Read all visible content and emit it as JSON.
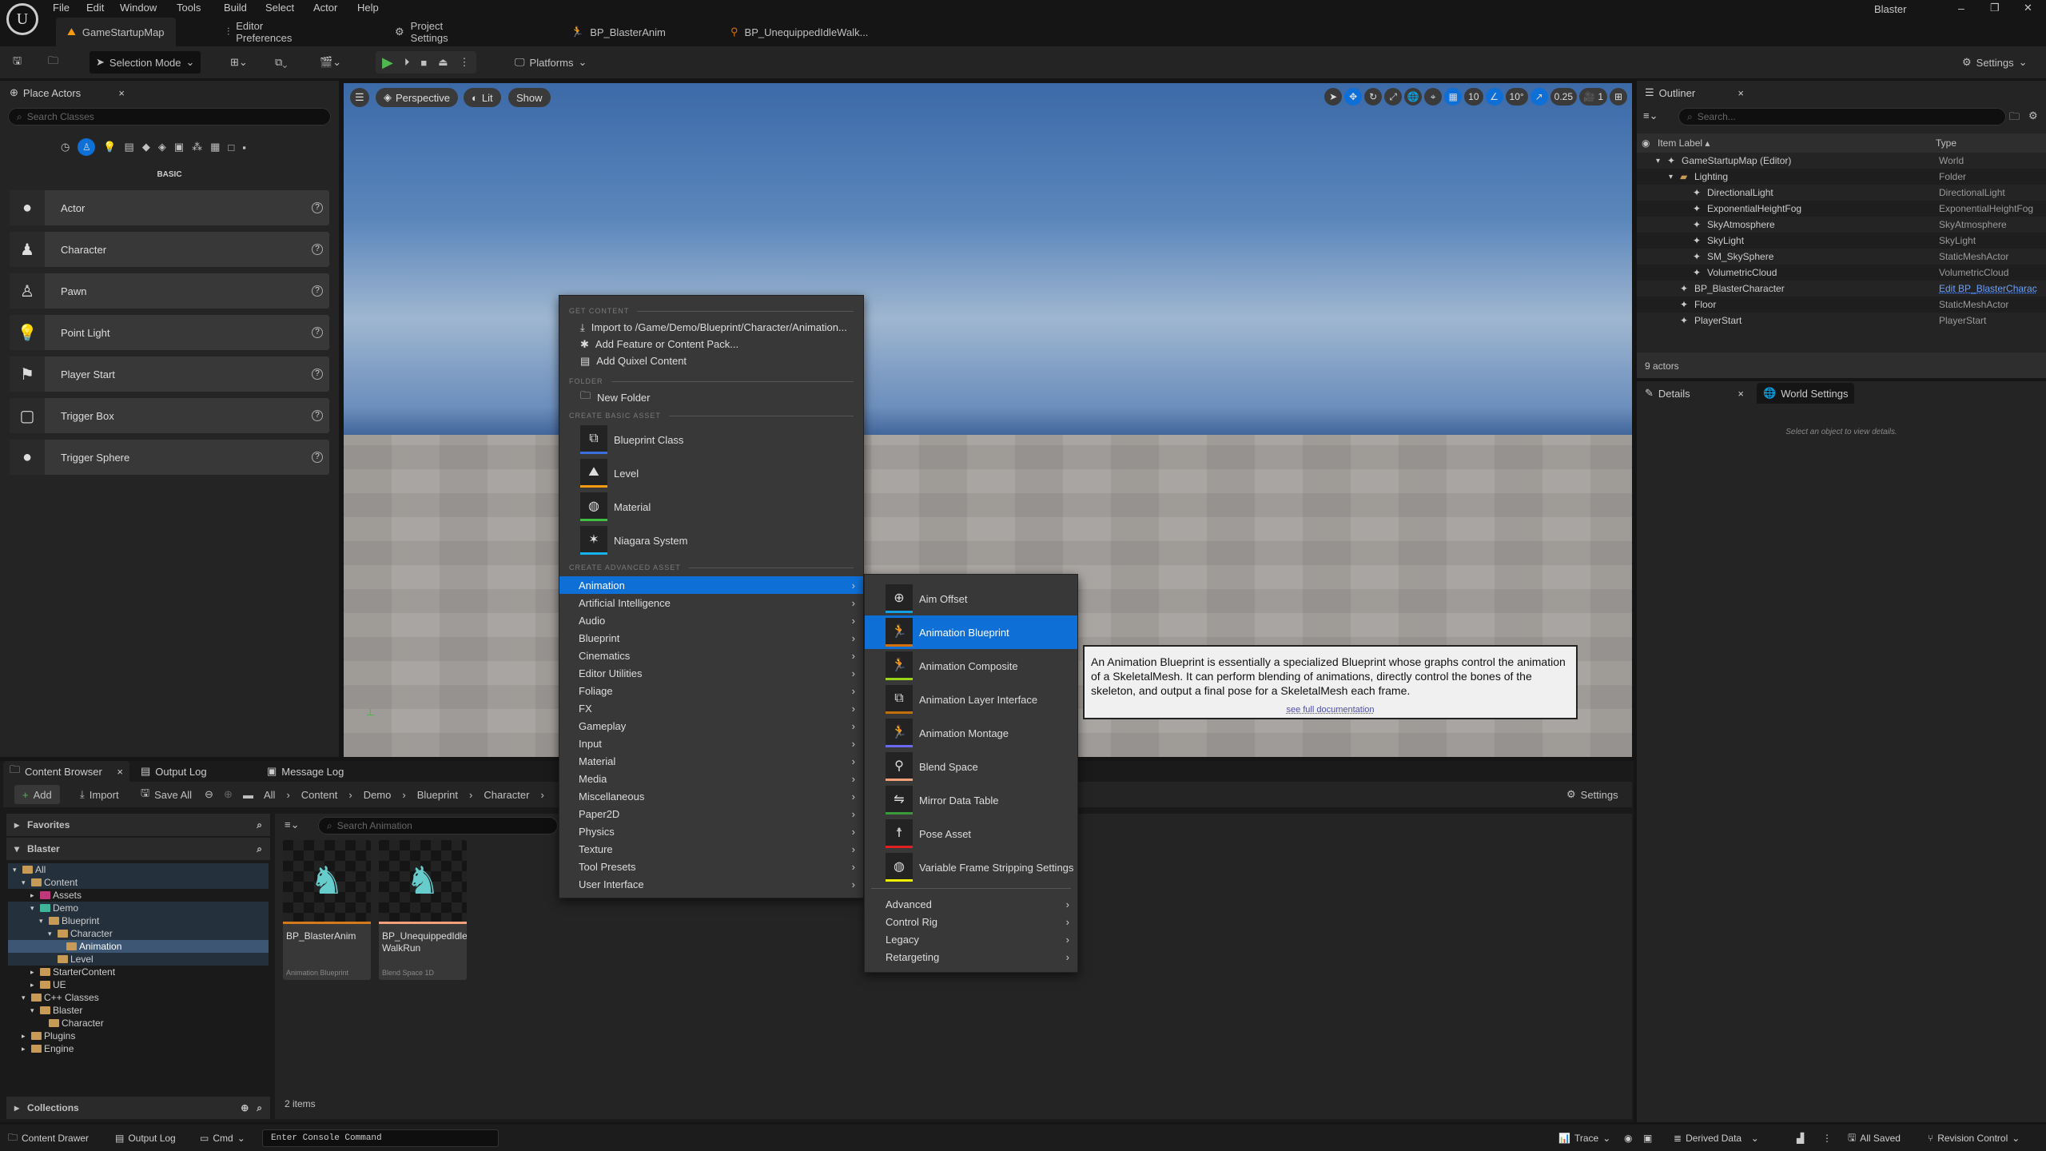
{
  "menubar": {
    "items": [
      "File",
      "Edit",
      "Window",
      "Tools",
      "Build",
      "Select",
      "Actor",
      "Help"
    ],
    "project": "Blaster"
  },
  "tabs": [
    {
      "label": "GameStartupMap",
      "icon": "level-icon"
    },
    {
      "label": "Editor Preferences",
      "icon": "sliders-icon"
    },
    {
      "label": "Project Settings",
      "icon": "gear-icon"
    },
    {
      "label": "BP_BlasterAnim",
      "icon": "anim-blueprint-icon"
    },
    {
      "label": "BP_UnequippedIdleWalk...",
      "icon": "blend-space-icon"
    }
  ],
  "toolbar": {
    "selection_mode": "Selection Mode",
    "platforms": "Platforms",
    "settings": "Settings"
  },
  "place_actors": {
    "title": "Place Actors",
    "search_placeholder": "Search Classes",
    "category": "BASIC",
    "items": [
      {
        "label": "Actor",
        "icon": "sphere-icon"
      },
      {
        "label": "Character",
        "icon": "character-icon"
      },
      {
        "label": "Pawn",
        "icon": "pawn-icon"
      },
      {
        "label": "Point Light",
        "icon": "bulb-icon"
      },
      {
        "label": "Player Start",
        "icon": "flag-icon"
      },
      {
        "label": "Trigger Box",
        "icon": "box-icon"
      },
      {
        "label": "Trigger Sphere",
        "icon": "sphere-icon"
      }
    ]
  },
  "viewport": {
    "perspective": "Perspective",
    "lit": "Lit",
    "show": "Show",
    "grid": "10",
    "angle": "10°",
    "scale": "0.25",
    "camera": "1"
  },
  "outliner": {
    "title": "Outliner",
    "search_placeholder": "Search...",
    "col_label": "Item Label",
    "col_type": "Type",
    "rows": [
      {
        "label": "GameStartupMap (Editor)",
        "type": "World",
        "depth": 0
      },
      {
        "label": "Lighting",
        "type": "Folder",
        "depth": 1
      },
      {
        "label": "DirectionalLight",
        "type": "DirectionalLight",
        "depth": 2
      },
      {
        "label": "ExponentialHeightFog",
        "type": "ExponentialHeightFog",
        "depth": 2
      },
      {
        "label": "SkyAtmosphere",
        "type": "SkyAtmosphere",
        "depth": 2
      },
      {
        "label": "SkyLight",
        "type": "SkyLight",
        "depth": 2
      },
      {
        "label": "SM_SkySphere",
        "type": "StaticMeshActor",
        "depth": 2
      },
      {
        "label": "VolumetricCloud",
        "type": "VolumetricCloud",
        "depth": 2
      },
      {
        "label": "BP_BlasterCharacter",
        "type": "Edit BP_BlasterCharac",
        "depth": 1,
        "link": true
      },
      {
        "label": "Floor",
        "type": "StaticMeshActor",
        "depth": 1
      },
      {
        "label": "PlayerStart",
        "type": "PlayerStart",
        "depth": 1
      }
    ],
    "count": "9 actors"
  },
  "details": {
    "tab": "Details",
    "world_settings": "World Settings",
    "empty": "Select an object to view details."
  },
  "bottom_tabs": {
    "content_browser": "Content Browser",
    "output_log": "Output Log",
    "message_log": "Message Log"
  },
  "content_browser": {
    "add": "Add",
    "import": "Import",
    "save_all": "Save All",
    "settings": "Settings",
    "breadcrumb": [
      "All",
      "Content",
      "Demo",
      "Blueprint",
      "Character"
    ],
    "favorites": "Favorites",
    "root": "Blaster",
    "collections": "Collections",
    "search_placeholder": "Search Animation",
    "count": "2 items",
    "tree": [
      {
        "label": "All",
        "depth": 0
      },
      {
        "label": "Content",
        "depth": 1
      },
      {
        "label": "Assets",
        "depth": 2,
        "color": "#c0397a"
      },
      {
        "label": "Demo",
        "depth": 2,
        "color": "#3fb59a"
      },
      {
        "label": "Blueprint",
        "depth": 3
      },
      {
        "label": "Character",
        "depth": 4
      },
      {
        "label": "Animation",
        "depth": 5,
        "selected": true
      },
      {
        "label": "Level",
        "depth": 4
      },
      {
        "label": "StarterContent",
        "depth": 2
      },
      {
        "label": "UE",
        "depth": 2
      },
      {
        "label": "C++ Classes",
        "depth": 1
      },
      {
        "label": "Blaster",
        "depth": 2
      },
      {
        "label": "Character",
        "depth": 3
      },
      {
        "label": "Plugins",
        "depth": 1
      },
      {
        "label": "Engine",
        "depth": 1
      }
    ],
    "assets": [
      {
        "name": "BP_BlasterAnim",
        "type": "Animation Blueprint",
        "color": "#d47a1a"
      },
      {
        "name": "BP_UnequippedIdle WalkRun",
        "type": "Blend Space 1D",
        "color": "#f4a07a"
      }
    ]
  },
  "context_menu": {
    "get_content": "GET CONTENT",
    "folder": "FOLDER",
    "create_basic": "CREATE BASIC ASSET",
    "create_advanced": "CREATE ADVANCED ASSET",
    "content_items": [
      "Import to /Game/Demo/Blueprint/Character/Animation...",
      "Add Feature or Content Pack...",
      "Add Quixel Content"
    ],
    "new_folder": "New Folder",
    "basic": [
      {
        "label": "Blueprint Class",
        "color": "#3b6fe0"
      },
      {
        "label": "Level",
        "color": "#f39c12"
      },
      {
        "label": "Material",
        "color": "#3fbf3f"
      },
      {
        "label": "Niagara System",
        "color": "#14b4f0"
      }
    ],
    "advanced": [
      "Animation",
      "Artificial Intelligence",
      "Audio",
      "Blueprint",
      "Cinematics",
      "Editor Utilities",
      "Foliage",
      "FX",
      "Gameplay",
      "Input",
      "Material",
      "Media",
      "Miscellaneous",
      "Paper2D",
      "Physics",
      "Texture",
      "Tool Presets",
      "User Interface"
    ]
  },
  "submenu": {
    "items": [
      {
        "label": "Aim Offset",
        "color": "#14a0e0"
      },
      {
        "label": "Animation Blueprint",
        "color": "#d4700a"
      },
      {
        "label": "Animation Composite",
        "color": "#9ad41a"
      },
      {
        "label": "Animation Layer Interface",
        "color": "#c4700a"
      },
      {
        "label": "Animation Montage",
        "color": "#6a6af0"
      },
      {
        "label": "Blend Space",
        "color": "#f4a07a"
      },
      {
        "label": "Mirror Data Table",
        "color": "#3a9a3a"
      },
      {
        "label": "Pose Asset",
        "color": "#e02020"
      },
      {
        "label": "Variable Frame Stripping Settings",
        "color": "#f0f000"
      }
    ],
    "more": [
      "Advanced",
      "Control Rig",
      "Legacy",
      "Retargeting"
    ]
  },
  "tooltip": {
    "text": "An Animation Blueprint is essentially a specialized Blueprint whose graphs control the animation of a SkeletalMesh. It can perform blending of animations, directly control the bones of the skeleton, and output a final pose for a SkeletalMesh each frame.",
    "link": "see full documentation"
  },
  "statusbar": {
    "content_drawer": "Content Drawer",
    "output_log": "Output Log",
    "cmd": "Cmd",
    "console_placeholder": "Enter Console Command",
    "trace": "Trace",
    "derived_data": "Derived Data",
    "all_saved": "All Saved",
    "revision_control": "Revision Control"
  },
  "colors": {
    "accent": "#0e6fd6",
    "play": "#4fb84f"
  }
}
